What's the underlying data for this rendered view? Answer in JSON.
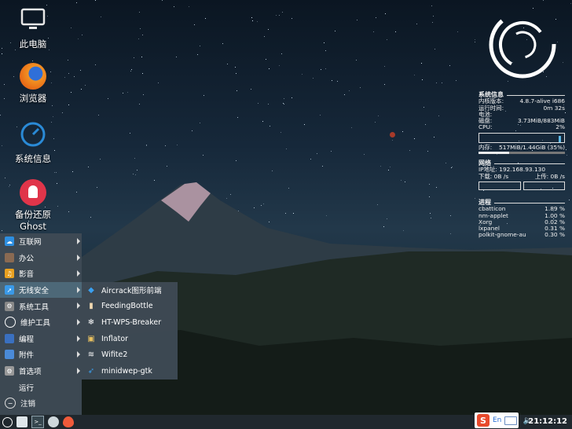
{
  "desktop_icons": [
    {
      "label": "此电脑",
      "icon": "monitor-icon"
    },
    {
      "label": "浏览器",
      "icon": "firefox-icon"
    },
    {
      "label": "系统信息",
      "icon": "speedometer-icon"
    },
    {
      "label": "备份还原\nGhost",
      "icon": "ghost-icon"
    }
  ],
  "conky": {
    "system_title": "系统信息",
    "kernel_label": "内核版本:",
    "kernel_value": "4.8.7-alive i686",
    "uptime_label": "运行时间:",
    "uptime_value": "0m 32s",
    "battery_label": "电池:",
    "disk_label": "磁盘:",
    "disk_value": "3.73MiB/883MiB",
    "cpu_label": "CPU:",
    "cpu_value": "2%",
    "mem_label": "内存:",
    "mem_value": "517MiB/1.44GiB (35%)",
    "mem_fraction": 0.35,
    "network_title": "网络",
    "ip_label": "IP地址:",
    "ip_value": "192.168.93.130",
    "down_label": "下载:",
    "down_value": "0B",
    "down_unit": "/s",
    "up_label": "上传:",
    "up_value": "0B",
    "up_unit": "/s",
    "process_title": "进程",
    "processes": [
      {
        "name": "cbatticon",
        "pct": "1.89 %"
      },
      {
        "name": "nm-applet",
        "pct": "1.00 %"
      },
      {
        "name": "Xorg",
        "pct": "0.02 %"
      },
      {
        "name": "lxpanel",
        "pct": "0.31 %"
      },
      {
        "name": "polkit-gnome-au",
        "pct": "0.30 %"
      }
    ]
  },
  "menu": {
    "items": [
      {
        "label": "互联网",
        "icon": "cloud-icon",
        "submenu": true
      },
      {
        "label": "办公",
        "icon": "briefcase-icon",
        "submenu": true
      },
      {
        "label": "影音",
        "icon": "media-icon",
        "submenu": true
      },
      {
        "label": "无线安全",
        "icon": "wireless-icon",
        "submenu": true,
        "active": true
      },
      {
        "label": "系统工具",
        "icon": "gear-icon",
        "submenu": true
      },
      {
        "label": "维护工具",
        "icon": "maintenance-icon",
        "submenu": true
      },
      {
        "label": "编程",
        "icon": "code-icon",
        "submenu": true
      },
      {
        "label": "附件",
        "icon": "accessories-icon",
        "submenu": true
      },
      {
        "label": "首选项",
        "icon": "preferences-icon",
        "submenu": true
      },
      {
        "label": "运行",
        "icon": "",
        "submenu": false
      },
      {
        "label": "注销",
        "icon": "logout-icon",
        "submenu": false
      }
    ],
    "submenu": [
      {
        "label": "Aircrack图形前端",
        "icon": "aircrack-icon"
      },
      {
        "label": "FeedingBottle",
        "icon": "bottle-icon"
      },
      {
        "label": "HT-WPS-Breaker",
        "icon": "snowflake-icon"
      },
      {
        "label": "Inflator",
        "icon": "inflator-icon"
      },
      {
        "label": "Wifite2",
        "icon": "wifi-icon"
      },
      {
        "label": "minidwep-gtk",
        "icon": "minidwep-icon"
      }
    ]
  },
  "taskbar": {
    "clock": "21:12:12",
    "ime": {
      "logo": "S",
      "mode": "En"
    }
  }
}
